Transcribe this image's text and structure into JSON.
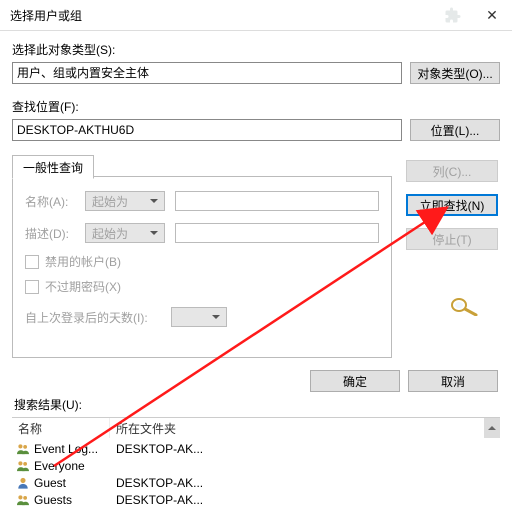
{
  "titlebar": {
    "title": "选择用户或组"
  },
  "object_type": {
    "label": "选择此对象类型(S):",
    "value": "用户、组或内置安全主体",
    "button": "对象类型(O)..."
  },
  "location": {
    "label": "查找位置(F):",
    "value": "DESKTOP-AKTHU6D",
    "button": "位置(L)..."
  },
  "tab": {
    "label": "一般性查询"
  },
  "panel": {
    "name_label": "名称(A):",
    "desc_label": "描述(D):",
    "combo_text": "起始为",
    "disabled_cb": "禁用的帐户(B)",
    "noexpire_cb": "不过期密码(X)",
    "days_label": "自上次登录后的天数(I):"
  },
  "side_buttons": {
    "columns": "列(C)...",
    "find_now": "立即查找(N)",
    "stop": "停止(T)"
  },
  "bottom": {
    "ok": "确定",
    "cancel": "取消"
  },
  "results": {
    "label": "搜索结果(U):",
    "col_name": "名称",
    "col_folder": "所在文件夹",
    "rows": [
      {
        "name": "Event Log...",
        "folder": "DESKTOP-AK...",
        "type": "group"
      },
      {
        "name": "Everyone",
        "folder": "",
        "type": "group"
      },
      {
        "name": "Guest",
        "folder": "DESKTOP-AK...",
        "type": "user"
      },
      {
        "name": "Guests",
        "folder": "DESKTOP-AK...",
        "type": "group"
      }
    ]
  }
}
